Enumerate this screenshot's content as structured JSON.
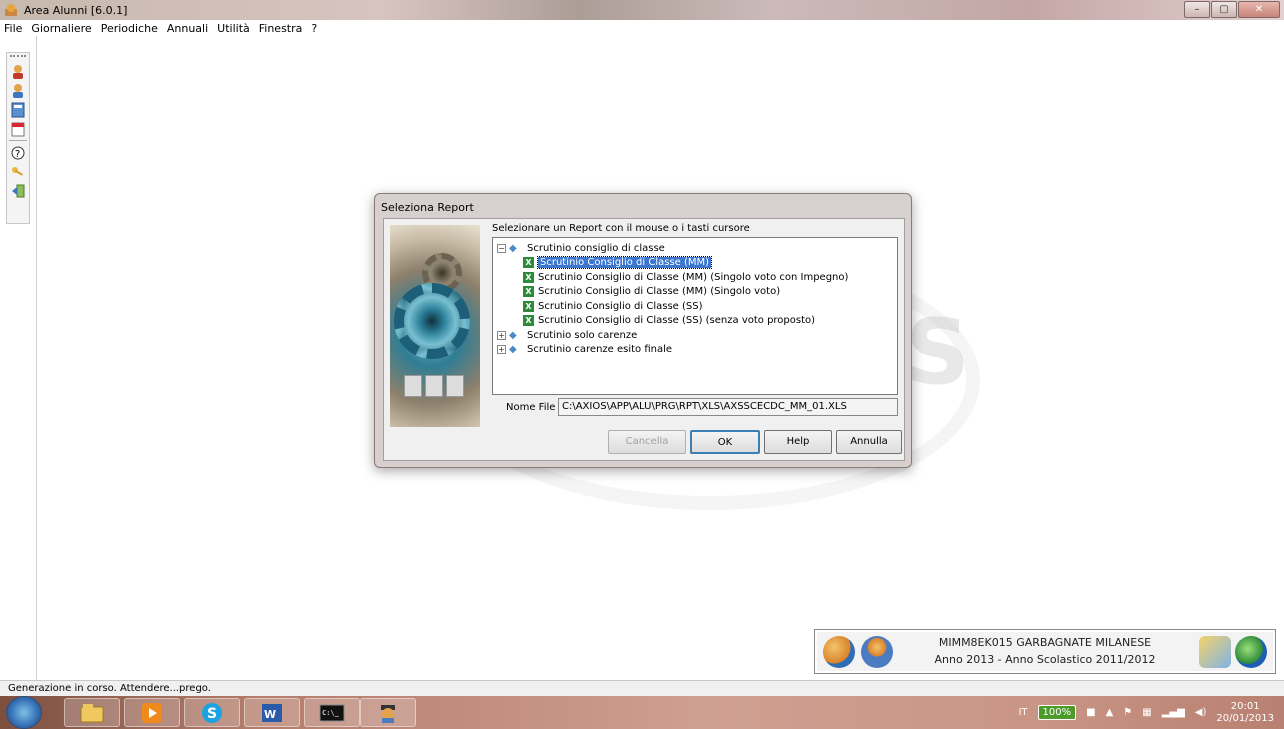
{
  "window": {
    "title": "Area Alunni [6.0.1]",
    "minimize": "–",
    "maximize": "▢",
    "close": "✕"
  },
  "menu": [
    "File",
    "Giornaliere",
    "Periodiche",
    "Annuali",
    "Utilità",
    "Finestra",
    "?"
  ],
  "toolbar_icons": [
    "user-icon",
    "user-alt-icon",
    "calculator-icon",
    "calendar-icon",
    "help-icon",
    "keys-icon",
    "exit-icon"
  ],
  "dialog": {
    "title": "Seleziona Report",
    "prompt": "Selezionare un Report con il mouse o i tasti cursore",
    "tree": [
      {
        "label": "Scrutinio consiglio di classe",
        "expanded": true,
        "children": [
          {
            "label": "Scrutinio Consiglio di Classe (MM)",
            "selected": true
          },
          {
            "label": "Scrutinio Consiglio di Classe (MM) (Singolo voto con Impegno)"
          },
          {
            "label": "Scrutinio Consiglio di Classe (MM) (Singolo voto)"
          },
          {
            "label": "Scrutinio Consiglio di Classe (SS)"
          },
          {
            "label": "Scrutinio Consiglio di Classe (SS) (senza voto proposto)"
          }
        ]
      },
      {
        "label": "Scrutinio solo carenze",
        "expanded": false
      },
      {
        "label": "Scrutinio carenze esito finale",
        "expanded": false
      }
    ],
    "nome_file_label": "Nome File",
    "nome_file_value": "C:\\AXIOS\\APP\\ALU\\PRG\\RPT\\XLS\\AXSSCECDC_MM_01.XLS",
    "buttons": {
      "cancella": "Cancella",
      "ok": "OK",
      "help": "Help",
      "annulla": "Annulla"
    }
  },
  "info": {
    "line1": "MIMM8EK015  GARBAGNATE MILANESE",
    "line2": "Anno 2013  -  Anno Scolastico 2011/2012"
  },
  "status": "Generazione in corso. Attendere...prego.",
  "tray": {
    "lang": "IT",
    "battery": "100%",
    "time": "20:01",
    "date": "20/01/2013"
  }
}
